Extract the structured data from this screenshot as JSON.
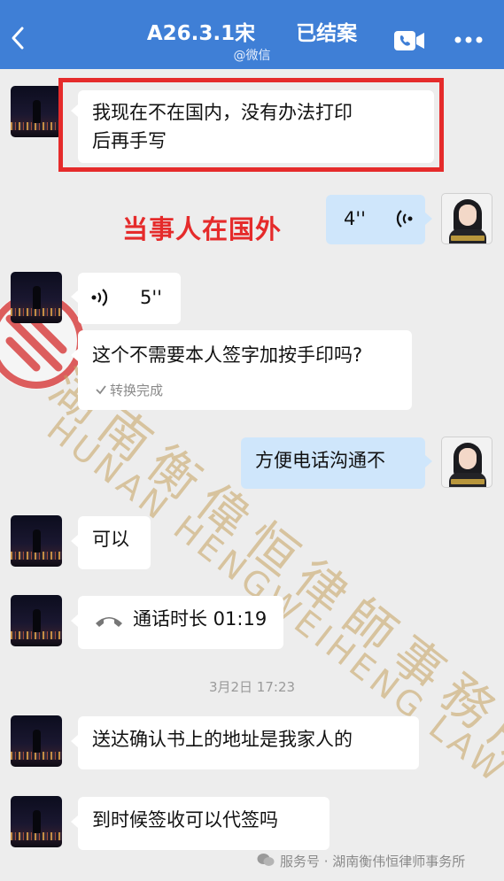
{
  "header": {
    "title": "A26.3.1宋　　已结案",
    "subtitle": "@微信"
  },
  "annotation": {
    "text": "当事人在国外"
  },
  "messages": [
    {
      "from": "peer",
      "type": "text",
      "text_line1": "我现在不在国内，没有办法打印",
      "text_line2": "后再手写"
    },
    {
      "from": "me",
      "type": "voice",
      "duration": "4''"
    },
    {
      "from": "peer",
      "type": "voice",
      "duration": "5''"
    },
    {
      "from": "peer",
      "type": "text",
      "text": "这个不需要本人签字加按手印吗?",
      "status": "转换完成"
    },
    {
      "from": "me",
      "type": "text",
      "text": "方便电话沟通不"
    },
    {
      "from": "peer",
      "type": "text",
      "text": "可以"
    },
    {
      "from": "peer",
      "type": "call",
      "text": "通话时长 01:19"
    },
    {
      "from": "peer",
      "type": "text",
      "text": "送达确认书上的地址是我家人的"
    },
    {
      "from": "peer",
      "type": "text",
      "text": "到时候签收可以代签吗"
    }
  ],
  "timestamp": "3月2日 17:23",
  "watermark": {
    "cn": "湖南衡偉恒律師事務所",
    "en": "HUNAN HENGWEIHENG LAW FIRM"
  },
  "footer": {
    "text": "服务号 · 湖南衡伟恒律师事务所"
  },
  "colors": {
    "header": "#3f7fd6",
    "my_bubble": "#cfe6fb",
    "highlight": "#e52b2b",
    "background": "#ededed"
  },
  "icons": {
    "back": "chevron-left-icon",
    "call": "video-call-icon",
    "more": "more-dots-icon",
    "phone": "phone-handset-icon",
    "voice": "voice-wave-icon",
    "wechat": "wechat-icon"
  }
}
